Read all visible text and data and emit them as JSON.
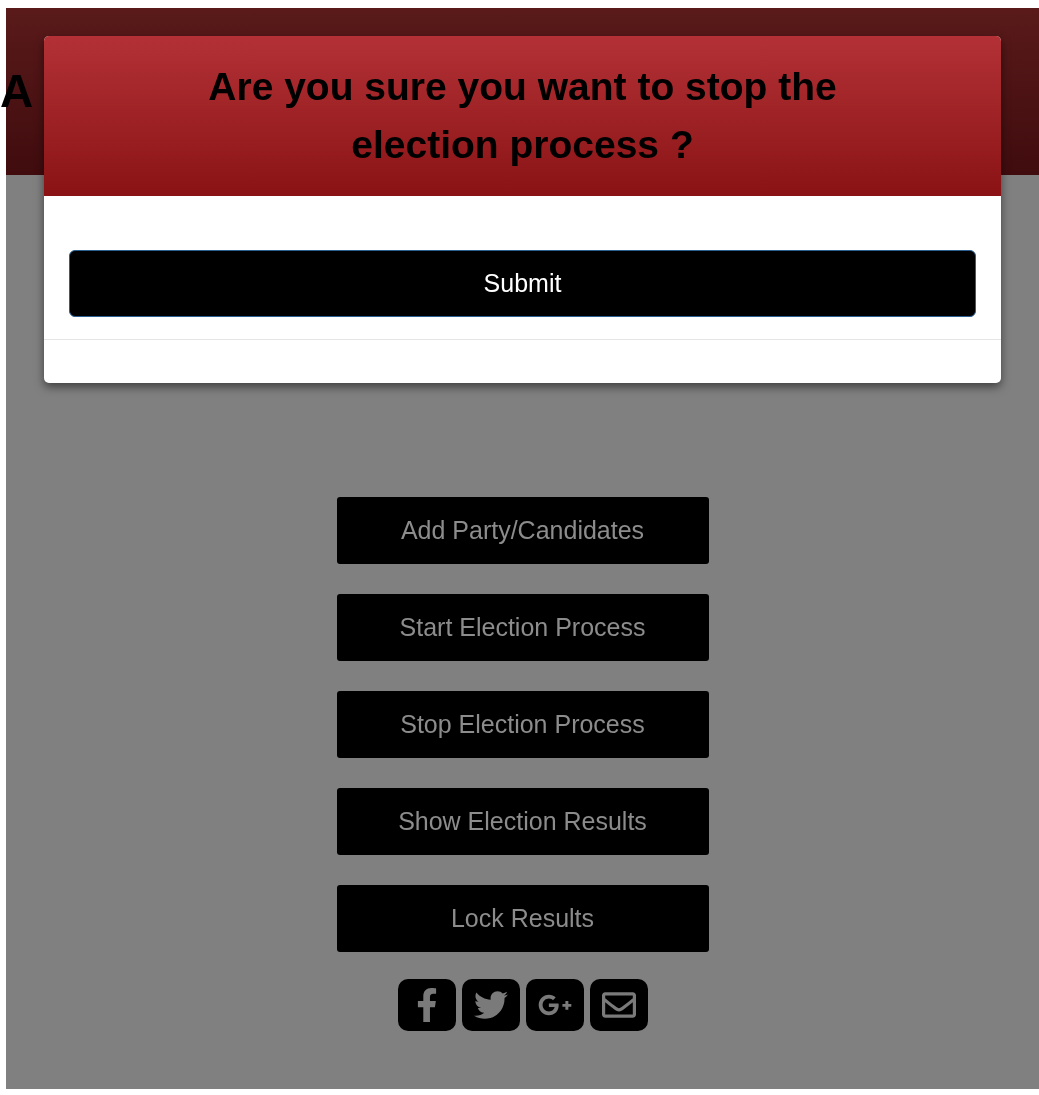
{
  "header": {
    "title": "A"
  },
  "modal": {
    "title": "Are you sure you want to stop the election process ?",
    "submit": "Submit"
  },
  "actions": [
    "Add Party/Candidates",
    "Start Election Process",
    "Stop Election Process",
    "Show Election Results",
    "Lock Results"
  ],
  "social": [
    {
      "kind": "facebook"
    },
    {
      "kind": "twitter"
    },
    {
      "kind": "googleplus"
    },
    {
      "kind": "email"
    }
  ]
}
